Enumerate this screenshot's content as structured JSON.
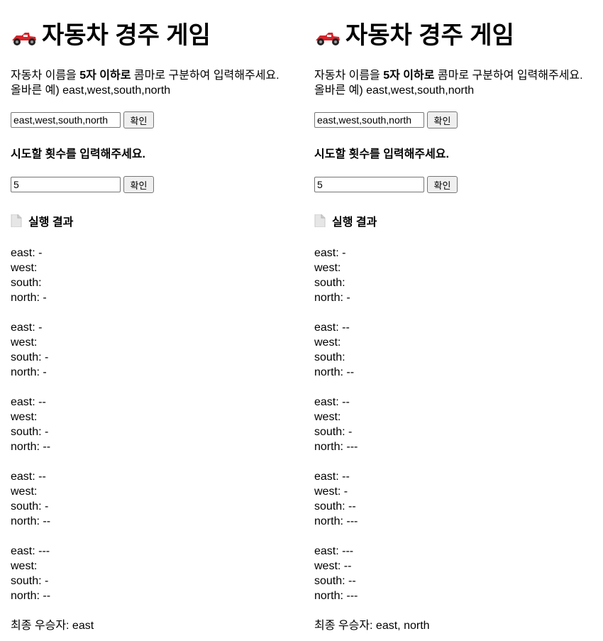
{
  "left": {
    "title": "자동차 경주 게임",
    "desc_pre": "자동차 이름을 ",
    "desc_bold": "5자 이하로",
    "desc_post": " 콤마로 구분하여 입력해주세요.",
    "example": "올바른 예) east,west,south,north",
    "names_value": "east,west,south,north",
    "names_button": "확인",
    "count_prompt": "시도할 횟수를 입력해주세요.",
    "count_value": "5",
    "count_button": "확인",
    "result_heading": "실행 결과",
    "rounds": [
      [
        "east: -",
        "west: ",
        "south: ",
        "north: -"
      ],
      [
        "east: -",
        "west: ",
        "south: -",
        "north: -"
      ],
      [
        "east: --",
        "west: ",
        "south: -",
        "north: --"
      ],
      [
        "east: --",
        "west: ",
        "south: -",
        "north: --"
      ],
      [
        "east: ---",
        "west: ",
        "south: -",
        "north: --"
      ]
    ],
    "winner": "최종 우승자: east"
  },
  "right": {
    "title": "자동차 경주 게임",
    "desc_pre": "자동차 이름을 ",
    "desc_bold": "5자 이하로",
    "desc_post": " 콤마로 구분하여 입력해주세요.",
    "example": "올바른 예) east,west,south,north",
    "names_value": "east,west,south,north",
    "names_button": "확인",
    "count_prompt": "시도할 횟수를 입력해주세요.",
    "count_value": "5",
    "count_button": "확인",
    "result_heading": "실행 결과",
    "rounds": [
      [
        "east: -",
        "west: ",
        "south: ",
        "north: -"
      ],
      [
        "east: --",
        "west: ",
        "south: ",
        "north: --"
      ],
      [
        "east: --",
        "west: ",
        "south: -",
        "north: ---"
      ],
      [
        "east: --",
        "west: -",
        "south: --",
        "north: ---"
      ],
      [
        "east: ---",
        "west: --",
        "south: --",
        "north: ---"
      ]
    ],
    "winner": "최종 우승자: east, north"
  },
  "icons": {
    "title_icon": "racing-car-icon",
    "result_icon": "page-document-icon"
  },
  "colors": {
    "car_red": "#d8232a",
    "text": "#000000",
    "button_bg": "#efefef",
    "border": "#767676"
  }
}
